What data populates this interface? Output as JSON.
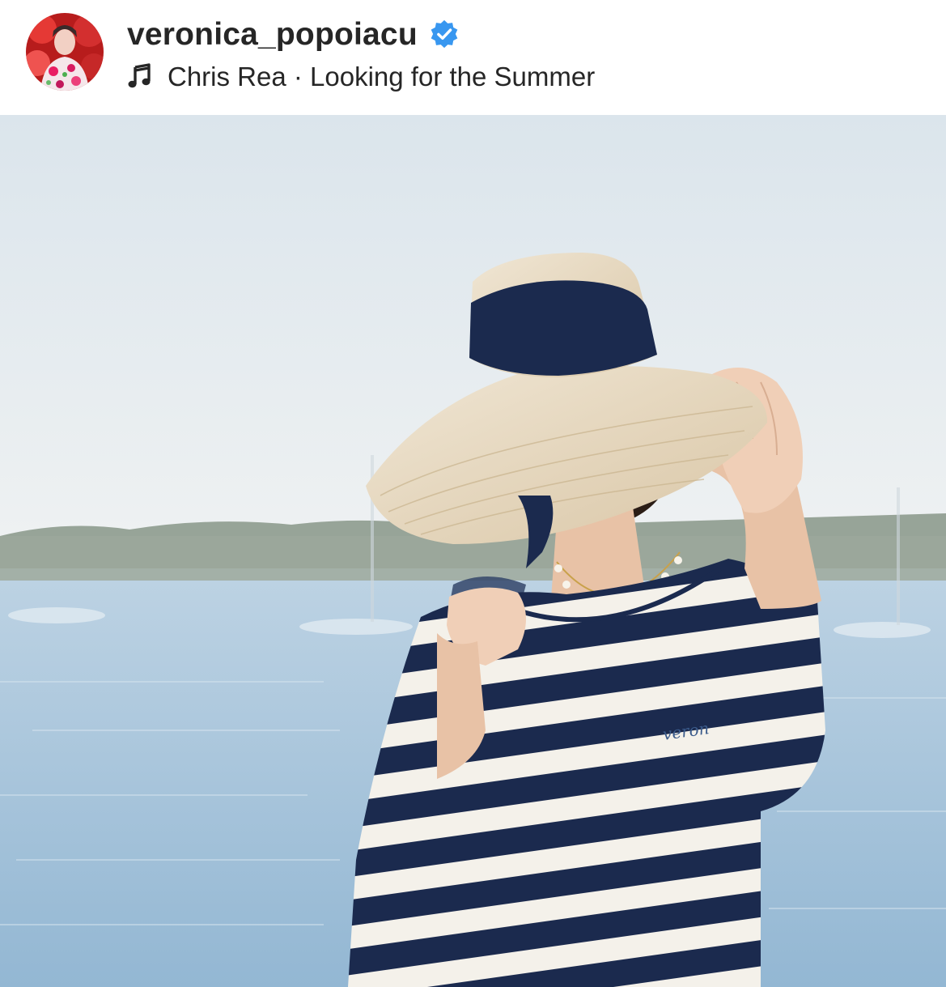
{
  "post": {
    "author": {
      "username": "veronica_popoiacu",
      "verified": true,
      "avatar_icon": "profile-avatar"
    },
    "audio": {
      "icon": "music-note-icon",
      "track": "Chris Rea · Looking for the Summer"
    },
    "photo": {
      "shirt_embroidery": "veron"
    }
  },
  "colors": {
    "text": "#262626",
    "verified_blue": "#3897f0",
    "navy": "#1b2a4e",
    "sea": "#a9c6dd",
    "sky": "#e8eef2",
    "straw": "#e9dcc6"
  }
}
